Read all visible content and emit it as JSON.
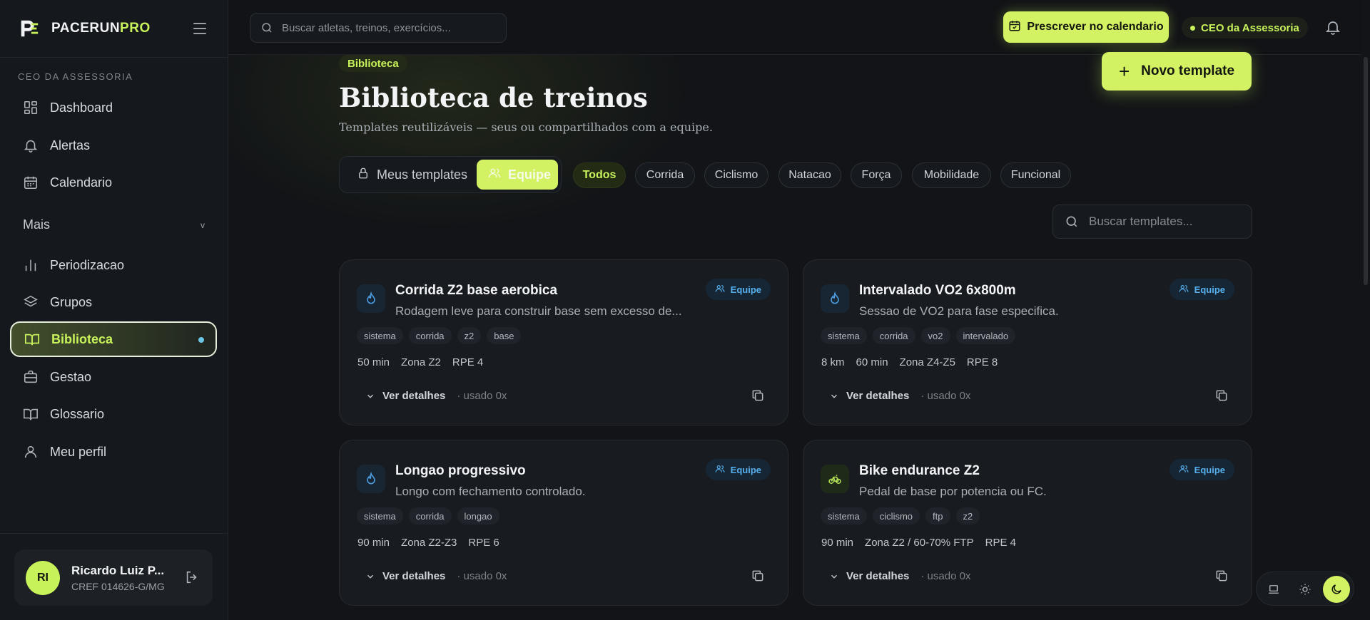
{
  "brand": {
    "name_main": "PACERUN",
    "name_accent": "PRO"
  },
  "sidebar": {
    "section_label": "CEO DA ASSESSORIA",
    "items_top": [
      {
        "label": "Dashboard",
        "icon": "dashboard-icon"
      },
      {
        "label": "Alertas",
        "icon": "bell-icon"
      },
      {
        "label": "Calendario",
        "icon": "calendar-icon"
      }
    ],
    "more_label": "Mais",
    "more_chevron": "v",
    "items_more": [
      {
        "label": "Periodizacao",
        "icon": "bar-chart-icon"
      },
      {
        "label": "Grupos",
        "icon": "layers-icon"
      },
      {
        "label": "Biblioteca",
        "icon": "book-open-icon",
        "active": true
      },
      {
        "label": "Gestao",
        "icon": "briefcase-icon"
      },
      {
        "label": "Glossario",
        "icon": "book-icon"
      },
      {
        "label": "Meu perfil",
        "icon": "user-icon"
      }
    ],
    "user": {
      "initials": "RI",
      "name": "Ricardo Luiz P...",
      "cref": "CREF 014626-G/MG"
    }
  },
  "topbar": {
    "search_placeholder": "Buscar atletas, treinos, exercícios...",
    "prescribe_label": "Prescrever no calendario",
    "role_label": "CEO da Assessoria"
  },
  "page": {
    "breadcrumb": "Biblioteca",
    "title": "Biblioteca de treinos",
    "subtitle": "Templates reutilizáveis — seus ou compartilhados com a equipe.",
    "new_template_label": "Novo template",
    "scope": {
      "mine": "Meus templates",
      "team": "Equipe",
      "selected": "team"
    },
    "filters": [
      "Todos",
      "Corrida",
      "Ciclismo",
      "Natacao",
      "Força",
      "Mobilidade",
      "Funcional"
    ],
    "selected_filter": "Todos",
    "template_search_placeholder": "Buscar templates..."
  },
  "templates": [
    {
      "title": "Corrida Z2 base aerobica",
      "description": "Rodagem leve para construir base sem excesso de...",
      "kind_icon": "flame-icon",
      "badge": "Equipe",
      "tags": [
        "sistema",
        "corrida",
        "z2",
        "base"
      ],
      "metrics": [
        "50 min",
        "Zona Z2",
        "RPE 4"
      ],
      "details_label": "Ver detalhes",
      "usage": "· usado 0x"
    },
    {
      "title": "Intervalado VO2 6x800m",
      "description": "Sessao de VO2 para fase especifica.",
      "kind_icon": "flame-icon",
      "badge": "Equipe",
      "tags": [
        "sistema",
        "corrida",
        "vo2",
        "intervalado"
      ],
      "metrics": [
        "8 km",
        "60 min",
        "Zona Z4-Z5",
        "RPE 8"
      ],
      "details_label": "Ver detalhes",
      "usage": "· usado 0x"
    },
    {
      "title": "Longao progressivo",
      "description": "Longo com fechamento controlado.",
      "kind_icon": "flame-icon",
      "badge": "Equipe",
      "tags": [
        "sistema",
        "corrida",
        "longao"
      ],
      "metrics": [
        "90 min",
        "Zona Z2-Z3",
        "RPE 6"
      ],
      "details_label": "Ver detalhes",
      "usage": "· usado 0x"
    },
    {
      "title": "Bike endurance Z2",
      "description": "Pedal de base por potencia ou FC.",
      "kind_icon": "bike-icon",
      "badge": "Equipe",
      "tags": [
        "sistema",
        "ciclismo",
        "ftp",
        "z2"
      ],
      "metrics": [
        "90 min",
        "Zona Z2 / 60-70% FTP",
        "RPE 4"
      ],
      "details_label": "Ver detalhes",
      "usage": "· usado 0x"
    }
  ],
  "theme": {
    "options": [
      "laptop-icon",
      "sun-icon",
      "moon-icon"
    ],
    "selected": "moon-icon"
  },
  "colors": {
    "accent": "#d3f263",
    "accent_text": "#c8f25a",
    "badge_blue": "#56b0ee",
    "background": "#121417"
  }
}
